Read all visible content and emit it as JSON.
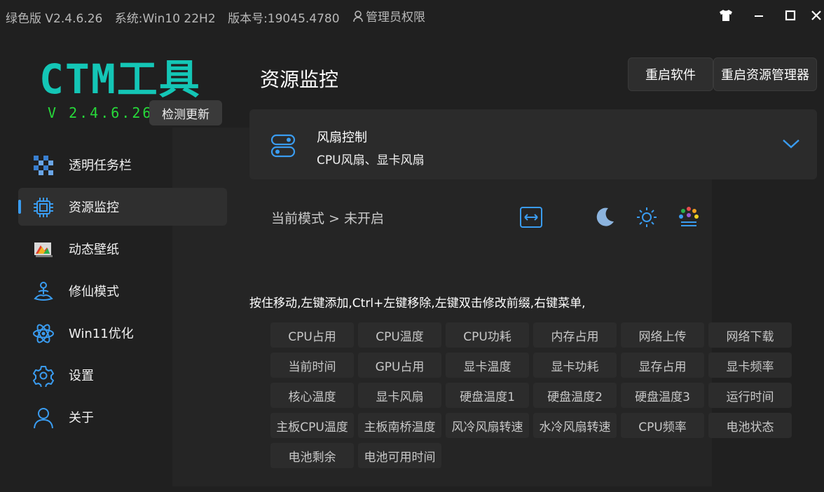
{
  "titlebar": {
    "edition": "绿色版 V2.4.6.26",
    "system": "系统:Win10 22H2",
    "build": "版本号:19045.4780",
    "admin": "管理员权限"
  },
  "brand": {
    "logo": "CTM工具",
    "version": "V 2.4.6.26",
    "check_update": "检测更新"
  },
  "sidebar": {
    "items": [
      {
        "label": "透明任务栏",
        "icon": "taskbar-icon",
        "active": false
      },
      {
        "label": "资源监控",
        "icon": "chip-icon",
        "active": true
      },
      {
        "label": "动态壁纸",
        "icon": "wallpaper-icon",
        "active": false
      },
      {
        "label": "修仙模式",
        "icon": "meditation-icon",
        "active": false
      },
      {
        "label": "Win11优化",
        "icon": "atom-icon",
        "active": false
      },
      {
        "label": "设置",
        "icon": "gear-icon",
        "active": false
      },
      {
        "label": "关于",
        "icon": "user-icon",
        "active": false
      }
    ]
  },
  "header": {
    "title": "资源监控",
    "restart_app": "重启软件",
    "restart_explorer": "重启资源管理器"
  },
  "fan_card": {
    "title": "风扇控制",
    "subtitle": "CPU风扇、显卡风扇"
  },
  "mode": {
    "text": "当前模式 > 未开启"
  },
  "hint": "按住移动,左键添加,Ctrl+左键移除,左键双击修改前缀,右键菜单,",
  "tags": [
    "CPU占用",
    "CPU温度",
    "CPU功耗",
    "内存占用",
    "网络上传",
    "网络下载",
    "当前时间",
    "GPU占用",
    "显卡温度",
    "显卡功耗",
    "显存占用",
    "显卡频率",
    "核心温度",
    "显卡风扇",
    "硬盘温度1",
    "硬盘温度2",
    "硬盘温度3",
    "运行时间",
    "主板CPU温度",
    "主板南桥温度",
    "风冷风扇转速",
    "水冷风扇转速",
    "CPU频率",
    "电池状态",
    "电池剩余",
    "电池可用时间"
  ],
  "colors": {
    "accent": "#3a9cf0",
    "logo": "#14c6b6",
    "version": "#27d93a",
    "background": "#202020"
  }
}
